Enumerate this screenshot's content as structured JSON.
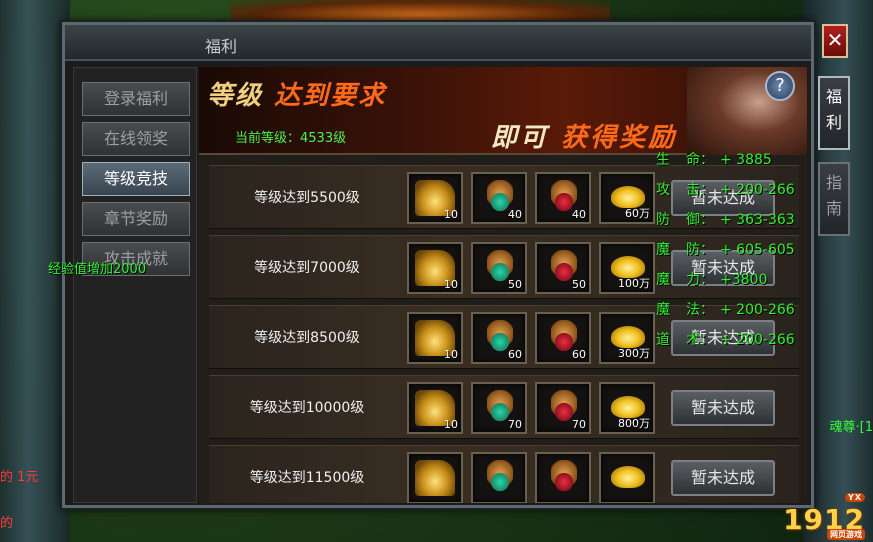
{
  "window": {
    "title": "福利",
    "close_label": "✕"
  },
  "nav": [
    {
      "label": "登录福利"
    },
    {
      "label": "在线领奖"
    },
    {
      "label": "等级竞技"
    },
    {
      "label": "章节奖励"
    },
    {
      "label": "攻击成就"
    }
  ],
  "nav_active": 2,
  "side_tabs": [
    {
      "label": "福利"
    },
    {
      "label": "指南"
    }
  ],
  "banner": {
    "title_a": "等级 ",
    "title_b": "达到要求",
    "current_level": "当前等级：4533级",
    "reward_a": "即可 ",
    "reward_b": "获得奖励",
    "help": "?"
  },
  "rows": [
    {
      "label": "等级达到5500级",
      "counts": [
        "10",
        "40",
        "40",
        "60万"
      ],
      "status": "暂未达成"
    },
    {
      "label": "等级达到7000级",
      "counts": [
        "10",
        "50",
        "50",
        "100万"
      ],
      "status": "暂未达成"
    },
    {
      "label": "等级达到8500级",
      "counts": [
        "10",
        "60",
        "60",
        "300万"
      ],
      "status": "暂未达成"
    },
    {
      "label": "等级达到10000级",
      "counts": [
        "10",
        "70",
        "70",
        "800万"
      ],
      "status": "暂未达成"
    },
    {
      "label": "等级达到11500级",
      "counts": [
        "",
        "",
        "",
        ""
      ],
      "status": "暂未达成"
    }
  ],
  "stats": [
    {
      "k1": "生",
      "k2": "命：",
      "v": "+ 3885"
    },
    {
      "k1": "攻",
      "k2": "击：",
      "v": "+ 200-266"
    },
    {
      "k1": "防",
      "k2": "御：",
      "v": "+ 363-363"
    },
    {
      "k1": "魔",
      "k2": "防：",
      "v": "+ 605-605"
    },
    {
      "k1": "魔",
      "k2": "力：",
      "v": "+3800"
    },
    {
      "k1": "魔",
      "k2": "法：",
      "v": "+ 200-266"
    },
    {
      "k1": "道",
      "k2": "术：",
      "v": "+ 200-266"
    }
  ],
  "exp_note": "经验值增加2000",
  "edge_left": {
    "line1": "的",
    "line1_yuan": "1元",
    "line2": "的"
  },
  "edge_right": "魂尊·[1",
  "site_logo": {
    "number": "1912",
    "sub": "网页游戏",
    "tag": "YX"
  },
  "colors": {
    "stat_green": "#33ee33",
    "accent_orange": "#ff6a1a",
    "close_red": "#b02020"
  }
}
